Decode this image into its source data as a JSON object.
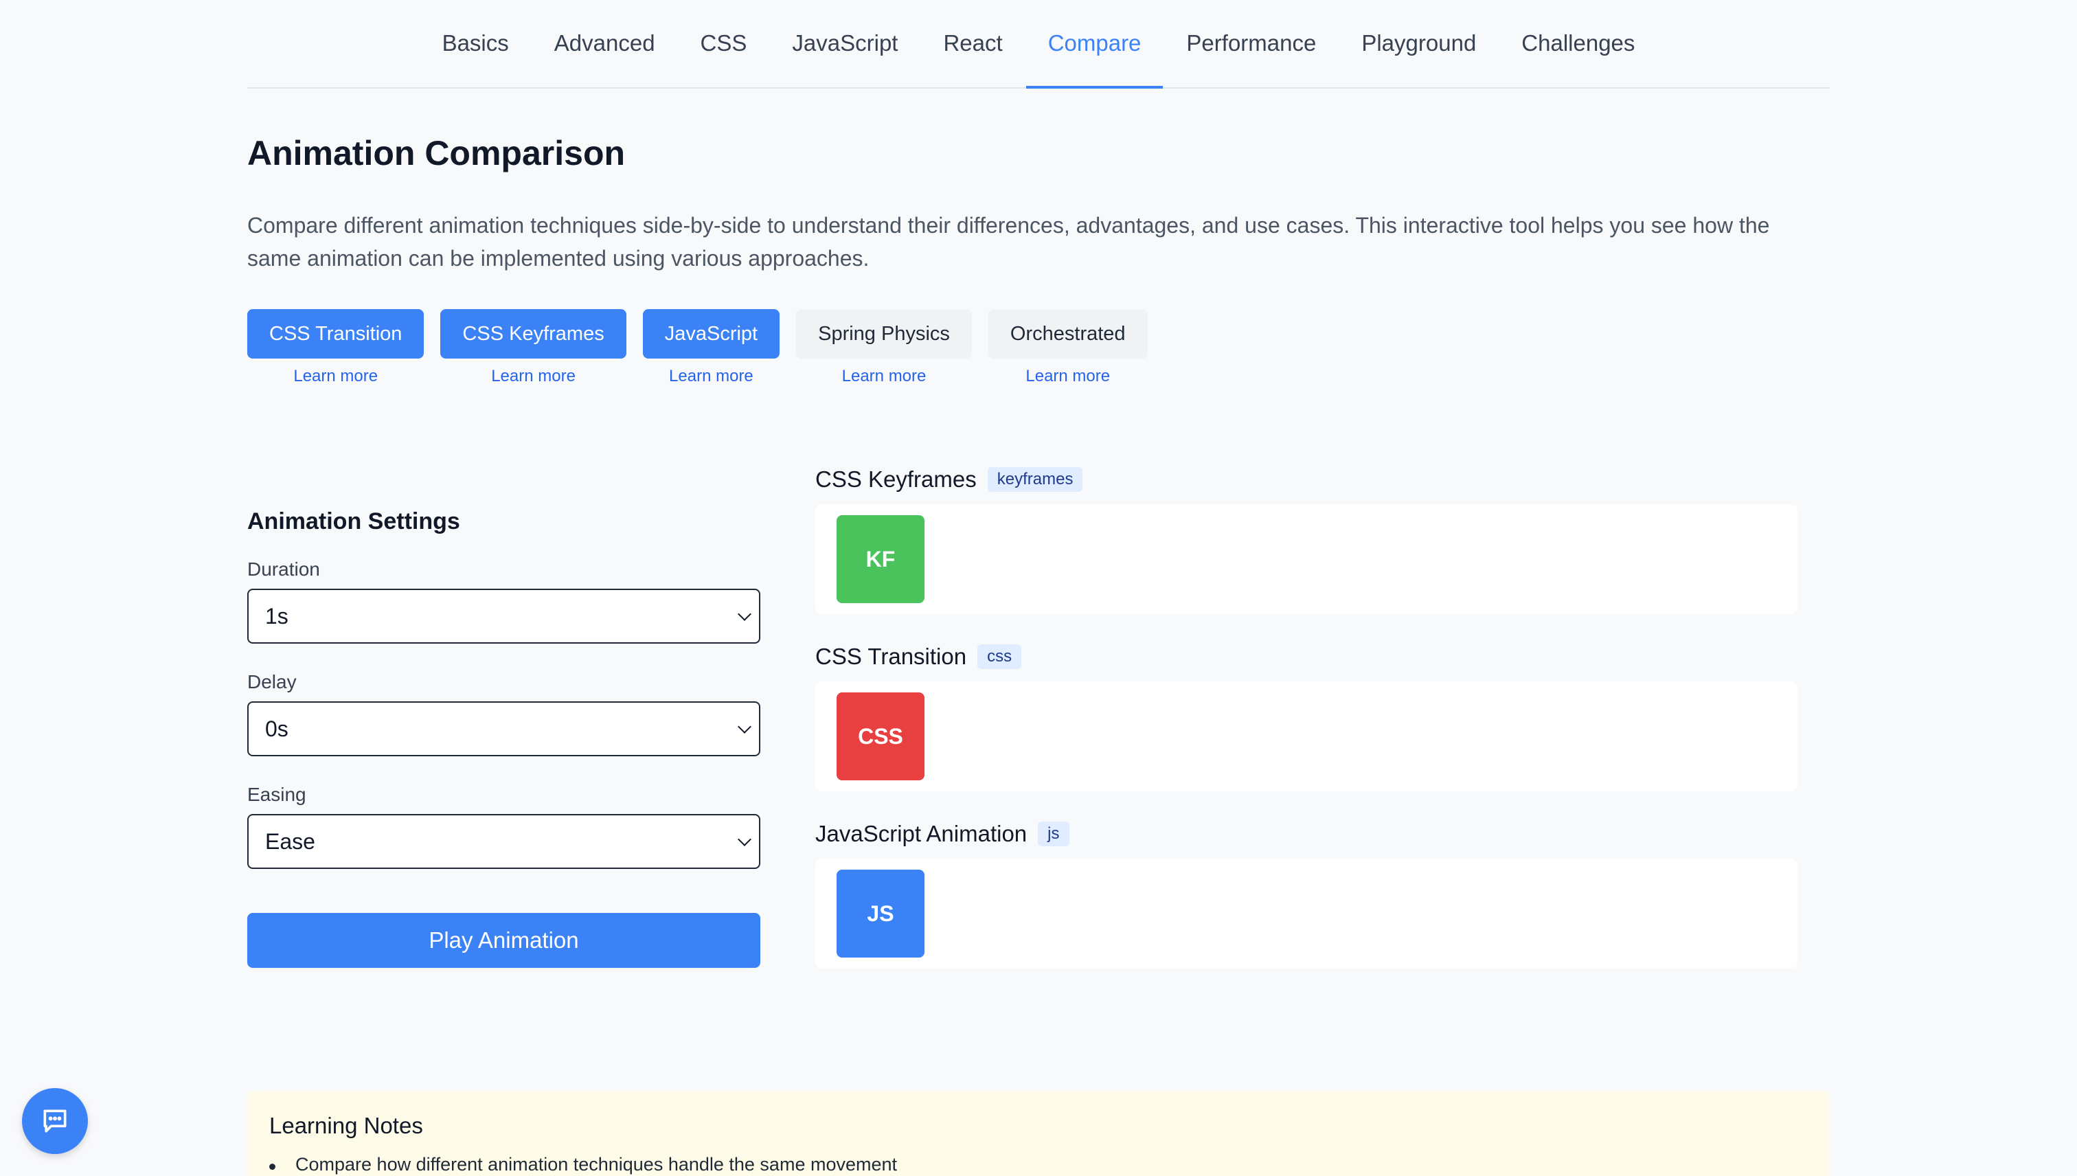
{
  "tabs": [
    {
      "label": "Basics"
    },
    {
      "label": "Advanced"
    },
    {
      "label": "CSS"
    },
    {
      "label": "JavaScript"
    },
    {
      "label": "React"
    },
    {
      "label": "Compare",
      "active": true
    },
    {
      "label": "Performance"
    },
    {
      "label": "Playground"
    },
    {
      "label": "Challenges"
    }
  ],
  "page": {
    "title": "Animation Comparison",
    "description": "Compare different animation techniques side-by-side to understand their differences, advantages, and use cases. This interactive tool helps you see how the same animation can be implemented using various approaches."
  },
  "techniques": [
    {
      "label": "CSS Transition",
      "selected": true,
      "learn": "Learn more"
    },
    {
      "label": "CSS Keyframes",
      "selected": true,
      "learn": "Learn more"
    },
    {
      "label": "JavaScript",
      "selected": true,
      "learn": "Learn more"
    },
    {
      "label": "Spring Physics",
      "selected": false,
      "learn": "Learn more"
    },
    {
      "label": "Orchestrated",
      "selected": false,
      "learn": "Learn more"
    }
  ],
  "settings": {
    "heading": "Animation Settings",
    "duration": {
      "label": "Duration",
      "value": "1s"
    },
    "delay": {
      "label": "Delay",
      "value": "0s"
    },
    "easing": {
      "label": "Easing",
      "value": "Ease"
    },
    "play_label": "Play Animation"
  },
  "demos": [
    {
      "title": "CSS Keyframes",
      "badge": "keyframes",
      "box": "KF",
      "color": "#4ac35d"
    },
    {
      "title": "CSS Transition",
      "badge": "css",
      "box": "CSS",
      "color": "#e84040"
    },
    {
      "title": "JavaScript Animation",
      "badge": "js",
      "box": "JS",
      "color": "#3b82f6"
    }
  ],
  "notes": {
    "heading": "Learning Notes",
    "items": [
      "Compare how different animation techniques handle the same movement"
    ]
  },
  "colors": {
    "accent": "#3b82f6",
    "notes_bg": "#fefce8"
  },
  "icons": {
    "chat": "chat-bubble-icon",
    "select": "chevron-down-icon"
  }
}
